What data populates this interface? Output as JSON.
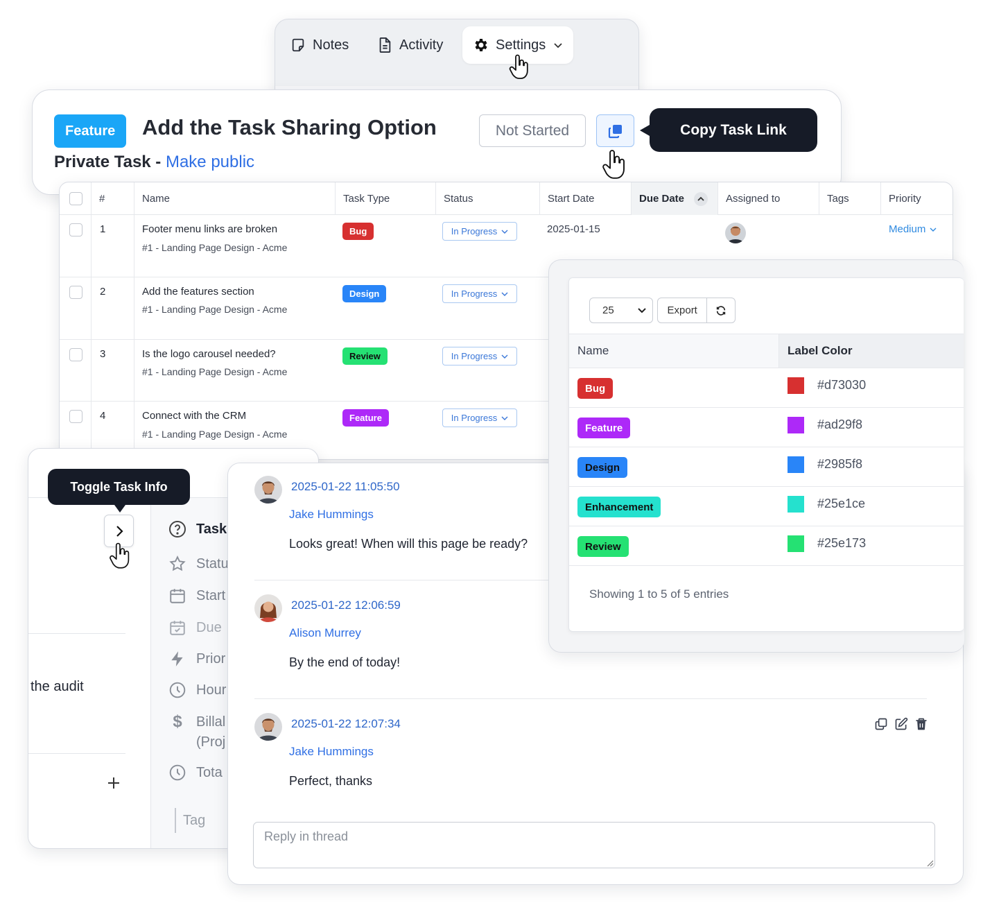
{
  "tabs": [
    {
      "label": "Notes",
      "icon": "note-icon",
      "active": false
    },
    {
      "label": "Activity",
      "icon": "document-icon",
      "active": false
    },
    {
      "label": "Settings",
      "icon": "gear-icon",
      "active": true
    }
  ],
  "task": {
    "type_badge": "Feature",
    "title": "Add the Task Sharing Option",
    "private_label": "Private Task",
    "separator": " - ",
    "make_public": "Make public",
    "status": "Not Started",
    "copy_tooltip": "Copy Task Link"
  },
  "table": {
    "columns": [
      "#",
      "Name",
      "Task Type",
      "Status",
      "Start Date",
      "Due Date",
      "Assigned to",
      "Tags",
      "Priority"
    ],
    "rows": [
      {
        "num": "1",
        "name": "Footer menu links are broken",
        "project": "#1 - Landing Page Design - Acme",
        "type": "Bug",
        "type_color": "#d73030",
        "status": "In Progress",
        "start_date": "2025-01-15",
        "priority": "Medium"
      },
      {
        "num": "2",
        "name": "Add the features section",
        "project": "#1 - Landing Page Design - Acme",
        "type": "Design",
        "type_color": "#2985f8",
        "status": "In Progress"
      },
      {
        "num": "3",
        "name": "Is the logo carousel needed?",
        "project": "#1 - Landing Page Design - Acme",
        "type": "Review",
        "type_color": "#25e173",
        "status": "In Progress"
      },
      {
        "num": "4",
        "name": "Connect with the CRM",
        "project": "#1 - Landing Page Design - Acme",
        "type": "Feature",
        "type_color": "#ad29f8",
        "status": "In Progress"
      }
    ]
  },
  "labels": {
    "page_size": "25",
    "export_label": "Export",
    "columns": [
      "Name",
      "Label Color"
    ],
    "rows": [
      {
        "name": "Bug",
        "color": "#d73030"
      },
      {
        "name": "Feature",
        "color": "#ad29f8"
      },
      {
        "name": "Design",
        "color": "#2985f8"
      },
      {
        "name": "Enhancement",
        "color": "#25e1ce"
      },
      {
        "name": "Review",
        "color": "#25e173"
      }
    ],
    "footer": "Showing 1 to 5 of 5 entries"
  },
  "task_info": {
    "toggle_tooltip": "Toggle Task Info",
    "heading": "Task",
    "items": [
      "Statu",
      "Start",
      "Due",
      "Prior",
      "Hour",
      "Billal",
      "(Proj",
      "Tota"
    ],
    "tag_placeholder": "Tag",
    "left_text": "the audit"
  },
  "comments": [
    {
      "time": "2025-01-22 11:05:50",
      "author": "Jake Hummings",
      "text": "Looks great! When will this page be ready?"
    },
    {
      "time": "2025-01-22 12:06:59",
      "author": "Alison Murrey",
      "text": "By the end of today!"
    },
    {
      "time": "2025-01-22 12:07:34",
      "author": "Jake Hummings",
      "text": "Perfect, thanks"
    }
  ],
  "reply": {
    "placeholder": "Reply in thread"
  }
}
